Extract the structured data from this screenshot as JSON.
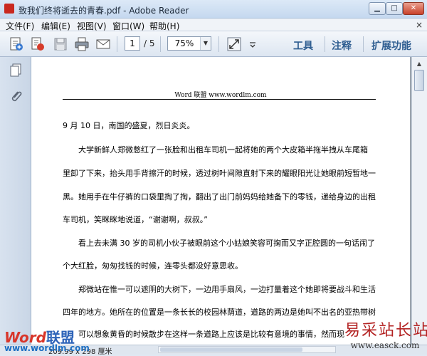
{
  "window": {
    "title": "致我们终将逝去的青春.pdf - Adobe Reader"
  },
  "menu": {
    "items": [
      "文件(F)",
      "编辑(E)",
      "视图(V)",
      "窗口(W)",
      "帮助(H)"
    ],
    "close_doc": "×"
  },
  "toolbar": {
    "current_page": "1",
    "total_pages": "/ 5",
    "zoom": "75%",
    "tools_label": "工具",
    "comment_label": "注释",
    "extend_label": "扩展功能"
  },
  "document": {
    "header": "Word 联盟  www.wordlm.com",
    "lines": [
      "9 月 10 日，南国的盛夏，烈日炎炎。",
      "大学新鲜人郑微憋红了一张脸和出租车司机一起将她的两个大皮箱半拖半拽从车尾箱",
      "里卸了下来，抬头用手背擦汗的时候，透过树叶间隙直射下来的耀眼阳光让她眼前短暂地一",
      "黑。她用手在牛仔裤的口袋里掏了掏，翻出了出门前妈妈给她备下的零钱，递给身边的出租",
      "车司机，笑眯眯地说道，“谢谢啊，叔叔。”",
      "看上去未满 30 岁的司机小伙子被眼前这个小姑娘笑容可掬而又字正腔圆的一句话闹了",
      "个大红脸，匆匆找钱的时候，连零头都没好意思收。",
      "郑微站在惟一可以遮阴的大树下，一边用手扇风，一边打量着这个她即将要战斗和生活",
      "四年的地方。她所在的位置是一条长长的校园林荫道，道路的两边是她叫不出名的亚热带树",
      "可以想象黄昏的时候散步在这样一条道路上应该是比较有意境的事情，然而现"
    ]
  },
  "status": {
    "page_size": "209.99 x 298 厘米"
  },
  "watermarks": {
    "left_word": "Word",
    "left_cn": "联盟",
    "left_url": "www.wordlm.com",
    "right_cn": "易采站长站",
    "right_url": "www.easck.com"
  }
}
